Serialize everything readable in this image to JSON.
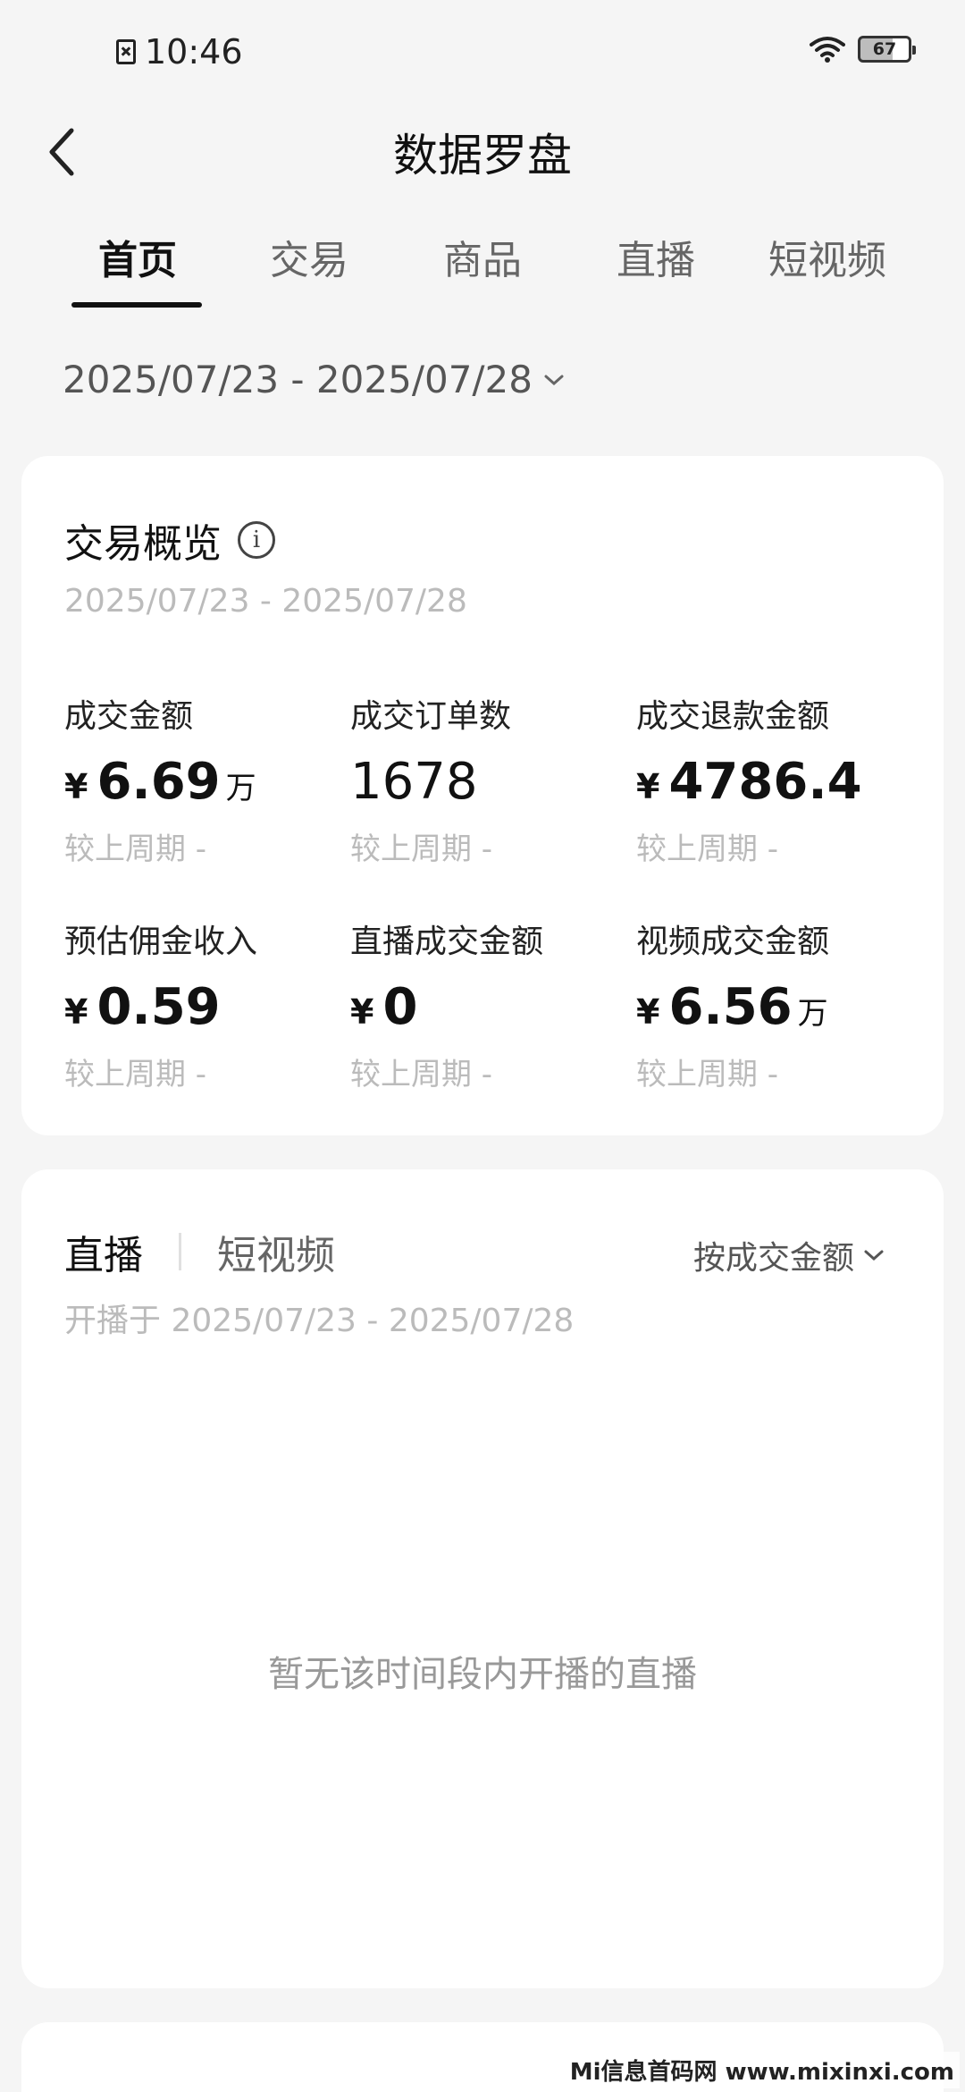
{
  "status_bar": {
    "time": "10:46",
    "battery": "67"
  },
  "nav": {
    "title": "数据罗盘"
  },
  "tabs": [
    {
      "label": "首页",
      "active": true
    },
    {
      "label": "交易",
      "active": false
    },
    {
      "label": "商品",
      "active": false
    },
    {
      "label": "直播",
      "active": false
    },
    {
      "label": "短视频",
      "active": false
    }
  ],
  "date_range": "2025/07/23 - 2025/07/28",
  "overview": {
    "title": "交易概览",
    "date_range": "2025/07/23 - 2025/07/28",
    "metrics": [
      {
        "label": "成交金额",
        "currency": "¥",
        "value": "6.69",
        "unit": "万",
        "compare": "较上周期 -"
      },
      {
        "label": "成交订单数",
        "currency": "",
        "value": "1678",
        "unit": "",
        "compare": "较上周期 -"
      },
      {
        "label": "成交退款金额",
        "currency": "¥",
        "value": "4786.4",
        "unit": "",
        "compare": "较上周期 -"
      },
      {
        "label": "预估佣金收入",
        "currency": "¥",
        "value": "0.59",
        "unit": "",
        "compare": "较上周期 -"
      },
      {
        "label": "直播成交金额",
        "currency": "¥",
        "value": "0",
        "unit": "",
        "compare": "较上周期 -"
      },
      {
        "label": "视频成交金额",
        "currency": "¥",
        "value": "6.56",
        "unit": "万",
        "compare": "较上周期 -"
      }
    ]
  },
  "live_section": {
    "tab_active": "直播",
    "tab_other": "短视频",
    "sort_label": "按成交金额",
    "subtitle": "开播于 2025/07/23 - 2025/07/28",
    "empty_text": "暂无该时间段内开播的直播"
  },
  "watermark": "Mi信息首码网 www.mixinxi.com"
}
